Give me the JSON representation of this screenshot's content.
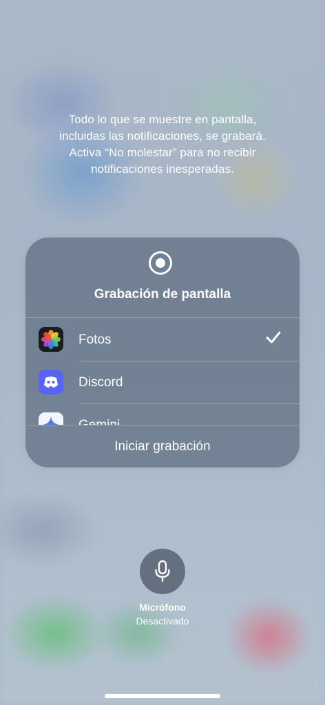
{
  "notice": {
    "lines": [
      "Todo lo que se muestre en pantalla,",
      "incluidas las notificaciones, se grabará.",
      "Activa “No molestar” para no recibir",
      "notificaciones inesperadas."
    ]
  },
  "panel": {
    "icon": "record-icon",
    "title": "Grabación de pantalla",
    "apps": [
      {
        "label": "Fotos",
        "icon": "photos-app-icon",
        "selected": true
      },
      {
        "label": "Discord",
        "icon": "discord-app-icon",
        "selected": false
      },
      {
        "label": "Gemini",
        "icon": "gemini-app-icon",
        "selected": false
      }
    ],
    "start_label": "Iniciar grabación"
  },
  "microphone": {
    "icon": "microphone-icon",
    "label": "Micrófono",
    "status": "Desactivado"
  },
  "colors": {
    "discord": "#5865F2",
    "panel": "#505f73"
  }
}
